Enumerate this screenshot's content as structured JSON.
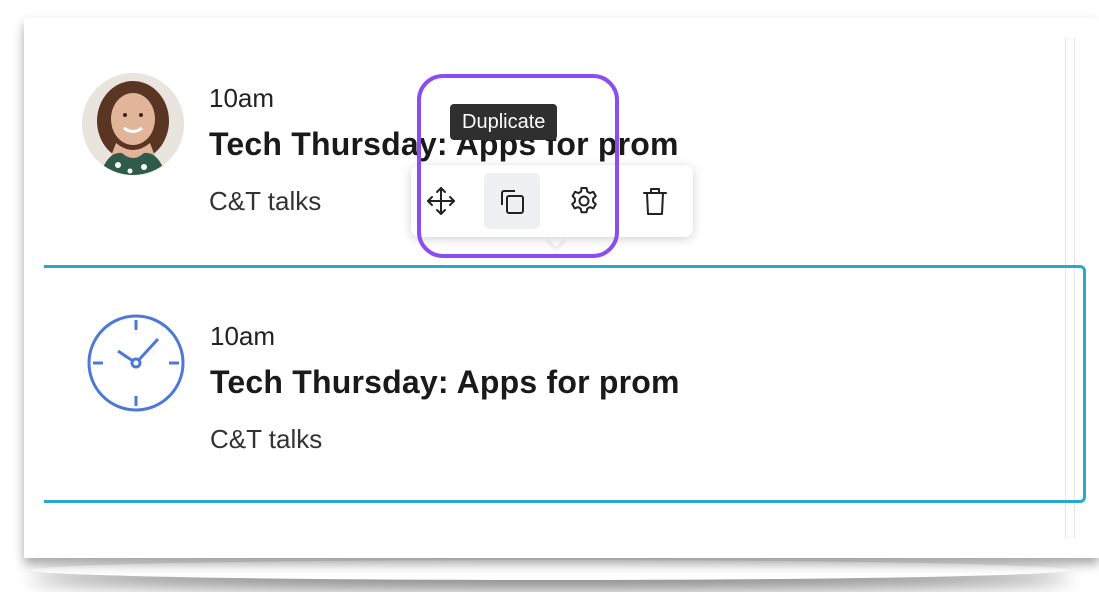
{
  "events": [
    {
      "time": "10am",
      "title": "Tech Thursday: Apps for prom",
      "category": "C&T talks"
    },
    {
      "time": "10am",
      "title": "Tech Thursday: Apps for prom",
      "category": "C&T talks"
    }
  ],
  "toolbar": {
    "tooltip": "Duplicate",
    "tools": [
      "move-icon",
      "duplicate-icon",
      "settings-icon",
      "delete-icon"
    ],
    "active_tool": "duplicate-icon"
  },
  "colors": {
    "selection_border": "#29a8cf",
    "highlight": "#8a4df0",
    "clock": "#4c78d6"
  }
}
